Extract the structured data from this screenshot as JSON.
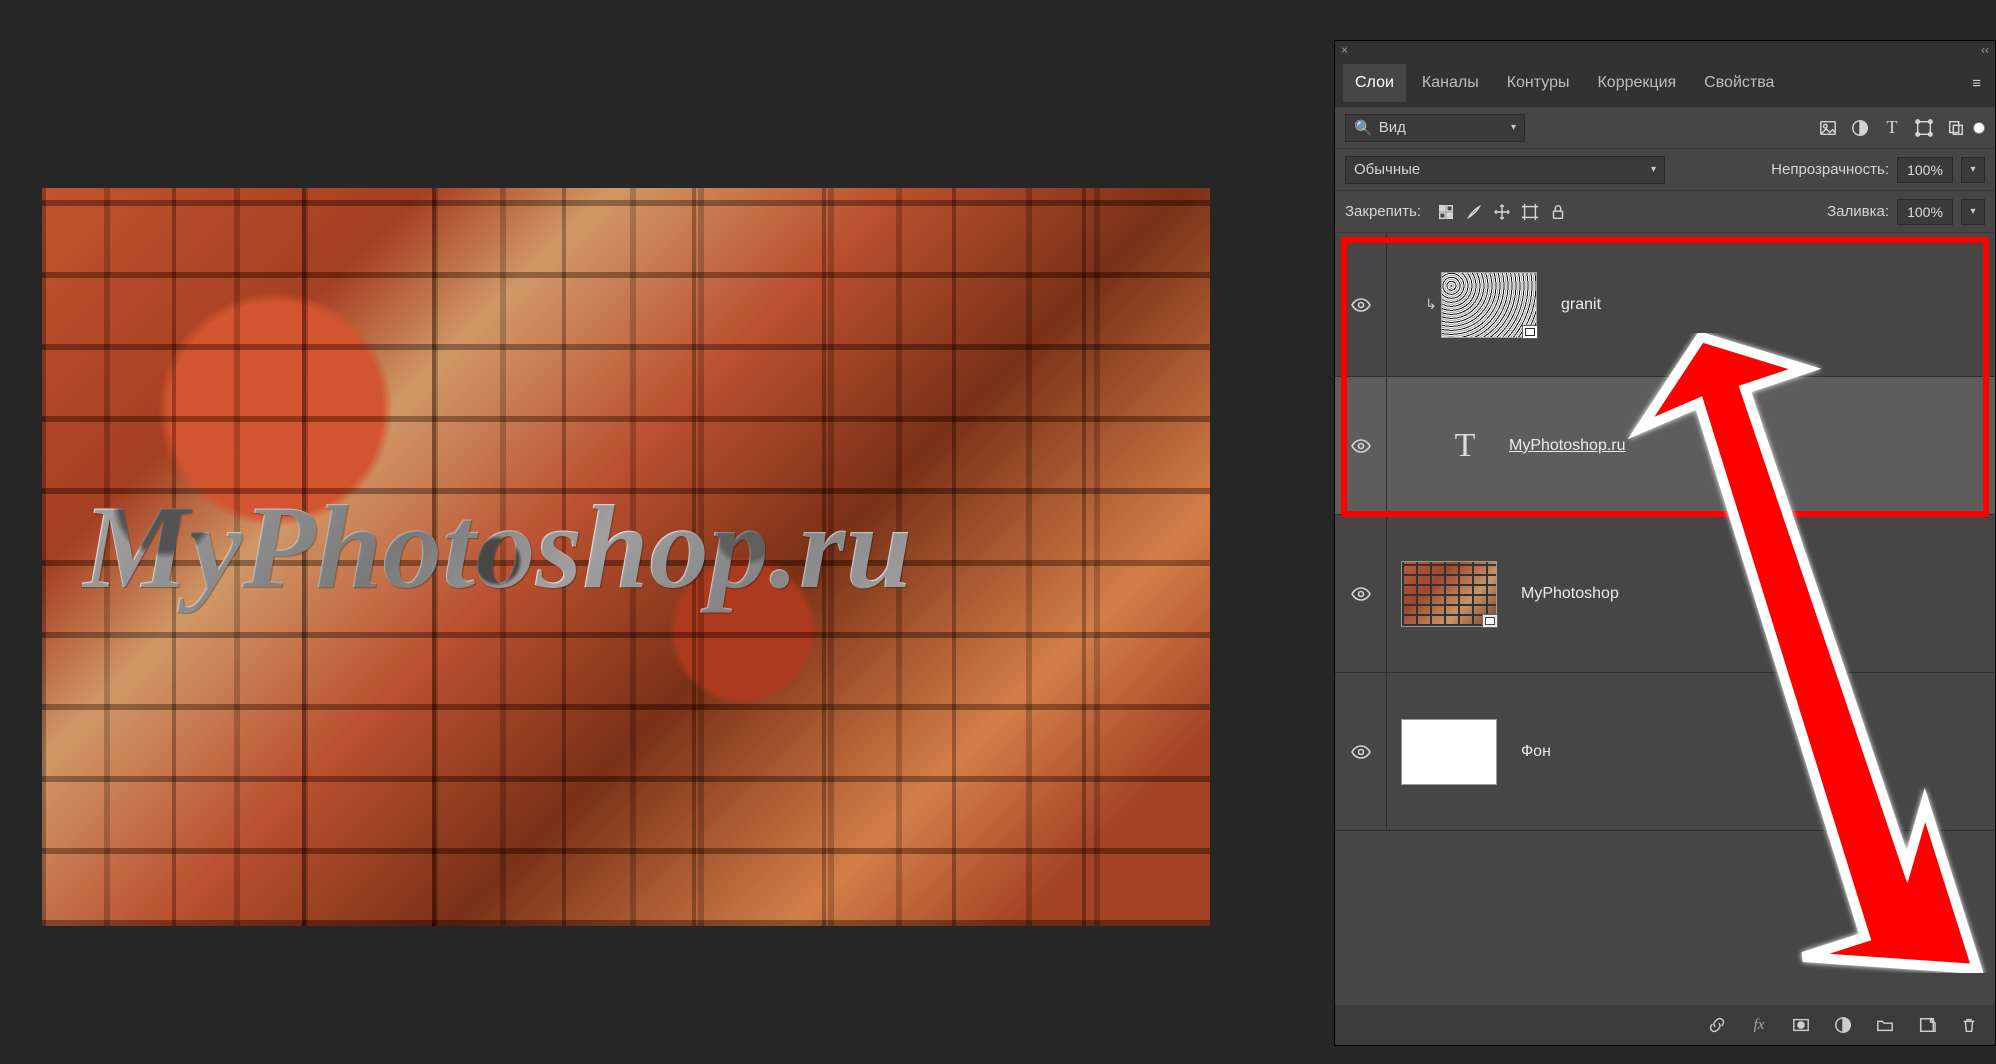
{
  "canvas": {
    "text": "MyPhotoshop.ru"
  },
  "panel": {
    "close_glyph": "×",
    "collapse_glyph": "‹‹",
    "tabs": [
      "Слои",
      "Каналы",
      "Контуры",
      "Коррекция",
      "Свойства"
    ],
    "active_tab_index": 0,
    "menu_glyph": "≡",
    "search": {
      "label": "Вид",
      "icon": "🔍"
    },
    "filter_icons": [
      "image",
      "adjust",
      "type",
      "shape",
      "smart"
    ],
    "blend": {
      "mode": "Обычные",
      "opacity_label": "Непрозрачность:",
      "opacity_value": "100%"
    },
    "lock": {
      "label": "Закрепить:",
      "fill_label": "Заливка:",
      "fill_value": "100%",
      "icons": [
        "pixels",
        "brush",
        "move",
        "crop",
        "lock"
      ]
    },
    "layers": [
      {
        "id": "granit",
        "name": "granit",
        "type": "smart",
        "thumb": "granite",
        "clipped": true,
        "visible": true
      },
      {
        "id": "text",
        "name": "MyPhotoshop.ru",
        "type": "type",
        "visible": true,
        "selected": true
      },
      {
        "id": "bricks",
        "name": "MyPhotoshop",
        "type": "smart",
        "thumb": "brick",
        "visible": true
      },
      {
        "id": "bg",
        "name": "Фон",
        "type": "raster",
        "thumb": "white",
        "visible": true
      }
    ],
    "bottom_icons": [
      "link",
      "fx",
      "mask",
      "adjustment",
      "group",
      "new",
      "trash"
    ]
  }
}
